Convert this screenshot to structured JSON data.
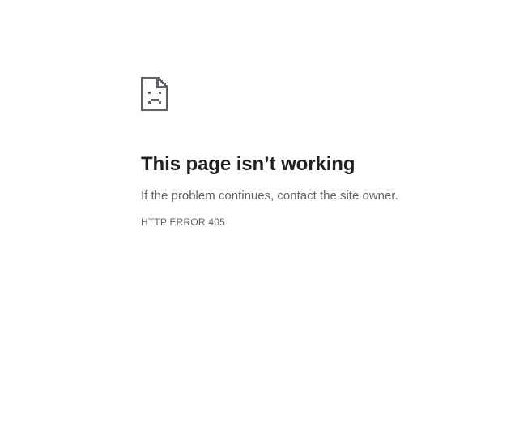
{
  "error_page": {
    "icon": "sad-page-icon",
    "heading": "This page isn’t working",
    "message": "If the problem continues, contact the site owner.",
    "error_code": "HTTP ERROR 405"
  },
  "colors": {
    "background": "#ffffff",
    "heading_text": "#202124",
    "body_text": "#5f6368",
    "icon": "#5f6368"
  }
}
